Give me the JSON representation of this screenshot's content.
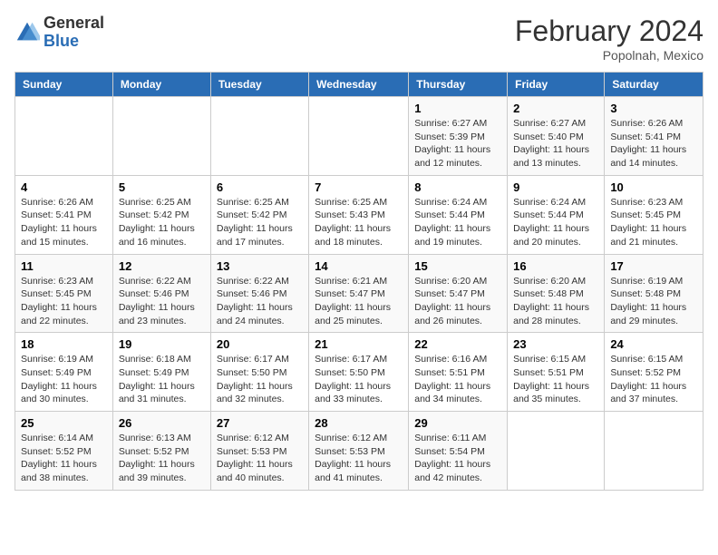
{
  "logo": {
    "general": "General",
    "blue": "Blue"
  },
  "title": "February 2024",
  "location": "Popolnah, Mexico",
  "days_header": [
    "Sunday",
    "Monday",
    "Tuesday",
    "Wednesday",
    "Thursday",
    "Friday",
    "Saturday"
  ],
  "weeks": [
    [
      {
        "num": "",
        "info": ""
      },
      {
        "num": "",
        "info": ""
      },
      {
        "num": "",
        "info": ""
      },
      {
        "num": "",
        "info": ""
      },
      {
        "num": "1",
        "info": "Sunrise: 6:27 AM\nSunset: 5:39 PM\nDaylight: 11 hours and 12 minutes."
      },
      {
        "num": "2",
        "info": "Sunrise: 6:27 AM\nSunset: 5:40 PM\nDaylight: 11 hours and 13 minutes."
      },
      {
        "num": "3",
        "info": "Sunrise: 6:26 AM\nSunset: 5:41 PM\nDaylight: 11 hours and 14 minutes."
      }
    ],
    [
      {
        "num": "4",
        "info": "Sunrise: 6:26 AM\nSunset: 5:41 PM\nDaylight: 11 hours and 15 minutes."
      },
      {
        "num": "5",
        "info": "Sunrise: 6:25 AM\nSunset: 5:42 PM\nDaylight: 11 hours and 16 minutes."
      },
      {
        "num": "6",
        "info": "Sunrise: 6:25 AM\nSunset: 5:42 PM\nDaylight: 11 hours and 17 minutes."
      },
      {
        "num": "7",
        "info": "Sunrise: 6:25 AM\nSunset: 5:43 PM\nDaylight: 11 hours and 18 minutes."
      },
      {
        "num": "8",
        "info": "Sunrise: 6:24 AM\nSunset: 5:44 PM\nDaylight: 11 hours and 19 minutes."
      },
      {
        "num": "9",
        "info": "Sunrise: 6:24 AM\nSunset: 5:44 PM\nDaylight: 11 hours and 20 minutes."
      },
      {
        "num": "10",
        "info": "Sunrise: 6:23 AM\nSunset: 5:45 PM\nDaylight: 11 hours and 21 minutes."
      }
    ],
    [
      {
        "num": "11",
        "info": "Sunrise: 6:23 AM\nSunset: 5:45 PM\nDaylight: 11 hours and 22 minutes."
      },
      {
        "num": "12",
        "info": "Sunrise: 6:22 AM\nSunset: 5:46 PM\nDaylight: 11 hours and 23 minutes."
      },
      {
        "num": "13",
        "info": "Sunrise: 6:22 AM\nSunset: 5:46 PM\nDaylight: 11 hours and 24 minutes."
      },
      {
        "num": "14",
        "info": "Sunrise: 6:21 AM\nSunset: 5:47 PM\nDaylight: 11 hours and 25 minutes."
      },
      {
        "num": "15",
        "info": "Sunrise: 6:20 AM\nSunset: 5:47 PM\nDaylight: 11 hours and 26 minutes."
      },
      {
        "num": "16",
        "info": "Sunrise: 6:20 AM\nSunset: 5:48 PM\nDaylight: 11 hours and 28 minutes."
      },
      {
        "num": "17",
        "info": "Sunrise: 6:19 AM\nSunset: 5:48 PM\nDaylight: 11 hours and 29 minutes."
      }
    ],
    [
      {
        "num": "18",
        "info": "Sunrise: 6:19 AM\nSunset: 5:49 PM\nDaylight: 11 hours and 30 minutes."
      },
      {
        "num": "19",
        "info": "Sunrise: 6:18 AM\nSunset: 5:49 PM\nDaylight: 11 hours and 31 minutes."
      },
      {
        "num": "20",
        "info": "Sunrise: 6:17 AM\nSunset: 5:50 PM\nDaylight: 11 hours and 32 minutes."
      },
      {
        "num": "21",
        "info": "Sunrise: 6:17 AM\nSunset: 5:50 PM\nDaylight: 11 hours and 33 minutes."
      },
      {
        "num": "22",
        "info": "Sunrise: 6:16 AM\nSunset: 5:51 PM\nDaylight: 11 hours and 34 minutes."
      },
      {
        "num": "23",
        "info": "Sunrise: 6:15 AM\nSunset: 5:51 PM\nDaylight: 11 hours and 35 minutes."
      },
      {
        "num": "24",
        "info": "Sunrise: 6:15 AM\nSunset: 5:52 PM\nDaylight: 11 hours and 37 minutes."
      }
    ],
    [
      {
        "num": "25",
        "info": "Sunrise: 6:14 AM\nSunset: 5:52 PM\nDaylight: 11 hours and 38 minutes."
      },
      {
        "num": "26",
        "info": "Sunrise: 6:13 AM\nSunset: 5:52 PM\nDaylight: 11 hours and 39 minutes."
      },
      {
        "num": "27",
        "info": "Sunrise: 6:12 AM\nSunset: 5:53 PM\nDaylight: 11 hours and 40 minutes."
      },
      {
        "num": "28",
        "info": "Sunrise: 6:12 AM\nSunset: 5:53 PM\nDaylight: 11 hours and 41 minutes."
      },
      {
        "num": "29",
        "info": "Sunrise: 6:11 AM\nSunset: 5:54 PM\nDaylight: 11 hours and 42 minutes."
      },
      {
        "num": "",
        "info": ""
      },
      {
        "num": "",
        "info": ""
      }
    ]
  ]
}
